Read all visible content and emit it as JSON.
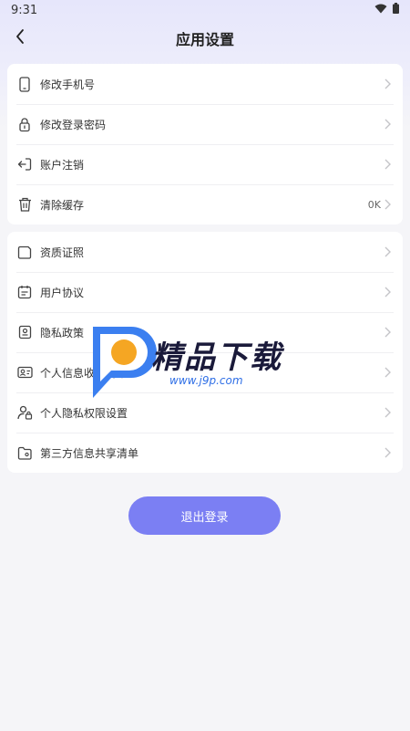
{
  "status_bar": {
    "time": "9:31"
  },
  "header": {
    "title": "应用设置"
  },
  "group1": [
    {
      "label": "修改手机号",
      "icon": "phone-icon"
    },
    {
      "label": "修改登录密码",
      "icon": "lock-icon"
    },
    {
      "label": "账户注销",
      "icon": "logout-icon"
    },
    {
      "label": "清除缓存",
      "icon": "trash-icon",
      "value": "0K"
    }
  ],
  "group2": [
    {
      "label": "资质证照",
      "icon": "folder-icon"
    },
    {
      "label": "用户协议",
      "icon": "agreement-icon"
    },
    {
      "label": "隐私政策",
      "icon": "privacy-icon"
    },
    {
      "label": "个人信息收集清单",
      "icon": "id-card-icon"
    },
    {
      "label": "个人隐私权限设置",
      "icon": "user-lock-icon"
    },
    {
      "label": "第三方信息共享清单",
      "icon": "shared-folder-icon"
    }
  ],
  "logout_button": {
    "label": "退出登录"
  },
  "watermark": {
    "brand": "精品下载",
    "url": "www.j9p.com"
  },
  "colors": {
    "accent": "#7b7ff3",
    "background": "#f5f5f8",
    "card": "#ffffff"
  }
}
